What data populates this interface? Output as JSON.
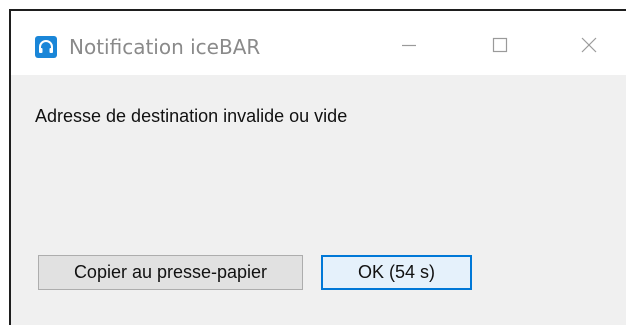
{
  "window": {
    "title": "Notification iceBAR",
    "app_icon": "headset-icon",
    "controls": {
      "minimize_icon": "minimize-icon",
      "maximize_icon": "maximize-icon",
      "close_icon": "close-icon"
    }
  },
  "dialog": {
    "message": "Adresse de destination invalide ou vide",
    "copy_button_label": "Copier au presse-papier",
    "ok_button_label": "OK (54 s)"
  },
  "colors": {
    "accent": "#0078d7",
    "icon_background": "#1a86d8",
    "title_text": "#8a8a8a",
    "client_background": "#f0f0f0"
  }
}
